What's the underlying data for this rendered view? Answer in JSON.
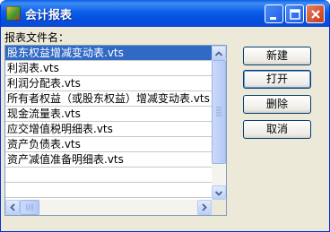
{
  "window": {
    "title": "会计报表"
  },
  "label": "报表文件名：",
  "files": [
    "股东权益增减变动表.vts",
    "利润表.vts",
    "利润分配表.vts",
    "所有者权益（或股东权益）增减变动表.vts",
    "现金流量表.vts",
    "应交增值税明细表.vts",
    "资产负债表.vts",
    "资产减值准备明细表.vts",
    "",
    "",
    ""
  ],
  "selected_index": 0,
  "buttons": {
    "new": "新建",
    "open": "打开",
    "delete": "删除",
    "cancel": "取消"
  }
}
